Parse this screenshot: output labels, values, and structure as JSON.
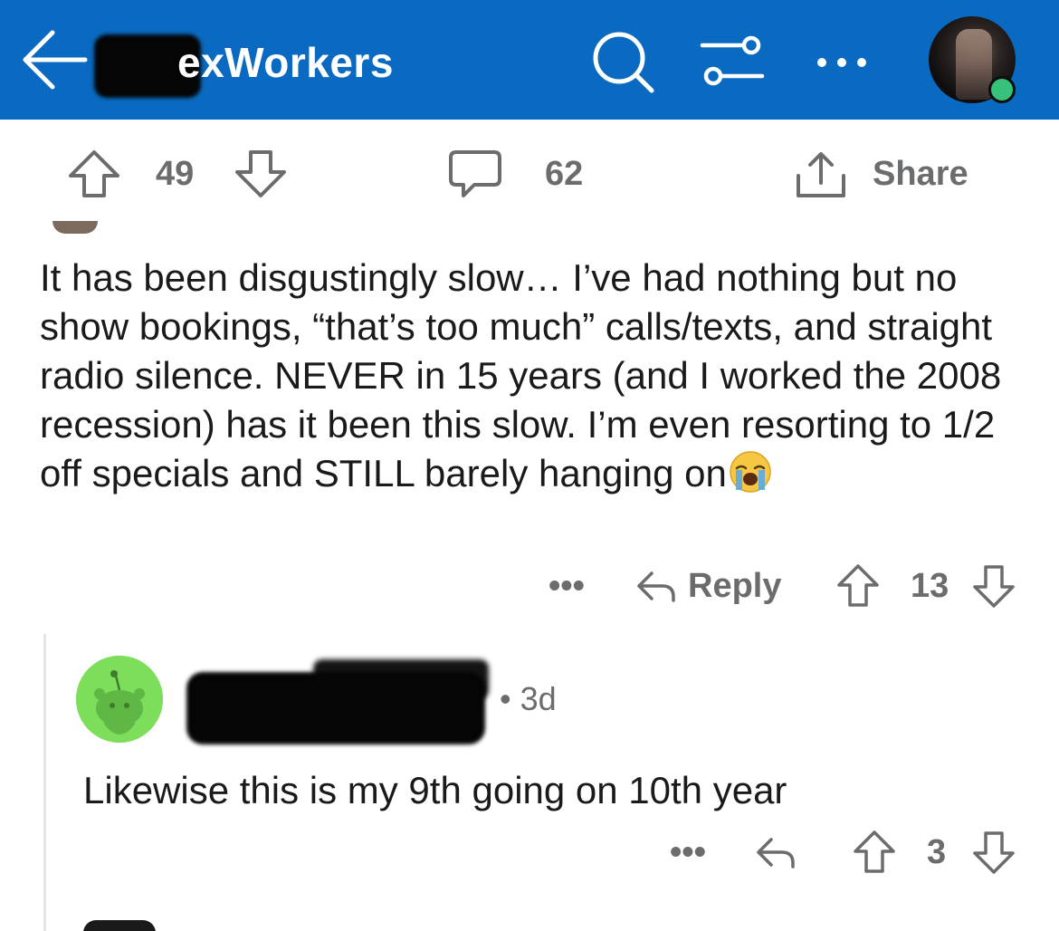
{
  "header": {
    "subreddit_title": "exWorkers",
    "colors": {
      "bar": "#0a6ac1",
      "online": "#36c27a"
    },
    "icons": [
      "back-arrow-icon",
      "search-icon",
      "filter-icon",
      "more-icon",
      "avatar"
    ]
  },
  "post_actions": {
    "upvotes": "49",
    "comments": "62",
    "share_label": "Share"
  },
  "comment": {
    "text": "It has been disgustingly slow… I’ve had nothing but no show bookings, “that’s too much” calls/texts, and straight radio silence. NEVER in 15 years (and I worked the 2008 recession) has it been this slow. I’m even resorting to 1/2 off specials and STILL barely hanging on",
    "emoji": "loudly-crying-face",
    "more": "•••",
    "reply_label": "Reply",
    "score": "13"
  },
  "reply": {
    "time": "• 3d",
    "text": "Likewise this is my 9th going on 10th year",
    "more": "•••",
    "score": "3"
  }
}
